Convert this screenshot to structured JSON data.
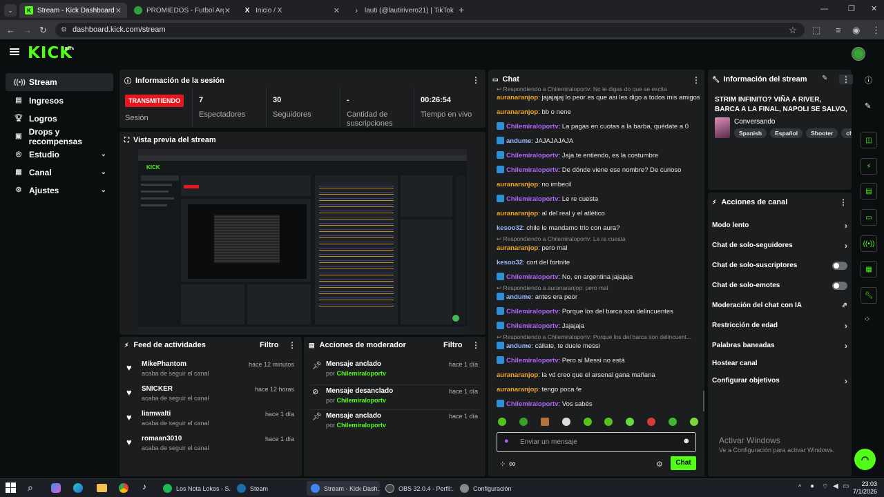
{
  "browser": {
    "tabs": [
      {
        "title": "Stream - Kick Dashboard",
        "icon": "kick-icon"
      },
      {
        "title": "PROMIEDOS - Futbol Argentino",
        "icon": "promiedos-icon"
      },
      {
        "title": "Inicio / X",
        "icon": "x-icon"
      },
      {
        "title": "lauti (@lautirivero21) | TikTok",
        "icon": "tiktok-icon"
      }
    ],
    "url": "dashboard.kick.com/stream"
  },
  "header": {
    "logo": "KICK",
    "logo_badge": "BETA"
  },
  "sidebar": {
    "items": [
      {
        "label": "Stream",
        "icon": "stream-icon",
        "active": true
      },
      {
        "label": "Ingresos",
        "icon": "revenue-icon"
      },
      {
        "label": "Logros",
        "icon": "trophy-icon"
      },
      {
        "label": "Drops y recompensas",
        "icon": "gift-icon"
      },
      {
        "label": "Estudio",
        "icon": "studio-icon",
        "expandable": true
      },
      {
        "label": "Canal",
        "icon": "channel-icon",
        "expandable": true
      },
      {
        "label": "Ajustes",
        "icon": "settings-icon",
        "expandable": true
      }
    ]
  },
  "session": {
    "title": "Información de la sesión",
    "status_badge": "TRANSMITIENDO",
    "stats": [
      {
        "value": "",
        "label": "Sesión"
      },
      {
        "value": "7",
        "label": "Espectadores"
      },
      {
        "value": "30",
        "label": "Seguidores"
      },
      {
        "value": "-",
        "label": "Cantidad de suscripciones"
      },
      {
        "value": "00:26:54",
        "label": "Tiempo en vivo"
      }
    ]
  },
  "preview": {
    "title": "Vista previa del stream"
  },
  "activity": {
    "title": "Feed de actividades",
    "filter": "Filtro",
    "items": [
      {
        "name": "MikePhantom",
        "sub": "acaba de seguir el canal",
        "time": "hace 12 minutos"
      },
      {
        "name": "SNICKER",
        "sub": "acaba de seguir el canal",
        "time": "hace 12 horas"
      },
      {
        "name": "liamwalti",
        "sub": "acaba de seguir el canal",
        "time": "hace 1 día"
      },
      {
        "name": "romaan3010",
        "sub": "acaba de seguir el canal",
        "time": "hace 1 día"
      }
    ]
  },
  "modactions": {
    "title": "Acciones de moderador",
    "filter": "Filtro",
    "items": [
      {
        "action": "Mensaje anclado",
        "by": "por",
        "user": "Chilemiraloportv",
        "time": "hace 1 día"
      },
      {
        "action": "Mensaje desanclado",
        "by": "por",
        "user": "Chilemiraloportv",
        "time": "hace 1 día"
      },
      {
        "action": "Mensaje anclado",
        "by": "por",
        "user": "Chilemiraloportv",
        "time": "hace 1 día"
      }
    ]
  },
  "chat": {
    "title": "Chat",
    "top_reply": "Respondiendo a Chilemiraloportv: No le digas do que se excita",
    "lines": [
      {
        "user": "auranaranjop",
        "color": "o",
        "text": "jajajajaj lo peor es que asi les digo a todos mis amigos"
      },
      {
        "user": "auranaranjop",
        "color": "o",
        "text": "bb o nene"
      },
      {
        "user": "Chilemiraloportv",
        "color": "p",
        "badge": true,
        "text": "La pagas en cuotas a la barba, quédate a 0"
      },
      {
        "user": "andume",
        "color": "b",
        "badge": true,
        "text": "JAJAJAJAJA"
      },
      {
        "user": "Chilemiraloportv",
        "color": "p",
        "badge": true,
        "text": "Jaja te entiendo, es la costumbre"
      },
      {
        "user": "Chilemiraloportv",
        "color": "p",
        "badge": true,
        "text": "De dónde viene ese nombre? De curioso"
      },
      {
        "user": "auranaranjop",
        "color": "o",
        "text": "no imbecil"
      },
      {
        "user": "Chilemiraloportv",
        "color": "p",
        "badge": true,
        "text": "Le re cuesta"
      },
      {
        "user": "auranaranjop",
        "color": "o",
        "text": "al del real y el atlético"
      },
      {
        "user": "kesoo32",
        "color": "b",
        "text": "chile le mandamo trio con aura?"
      },
      {
        "reply": "Respondiendo a Chilemiraloportv: Le re cuesta",
        "user": "auranaranjop",
        "color": "o",
        "text": "pero mal"
      },
      {
        "user": "kesoo32",
        "color": "b",
        "text": "cort del fortnite"
      },
      {
        "user": "Chilemiraloportv",
        "color": "p",
        "badge": true,
        "text": "No, en argentina jajajaja"
      },
      {
        "reply": "Respondiendo a auranaranjop: pero mal",
        "user": "andume",
        "color": "b",
        "badge": true,
        "text": "antes era peor"
      },
      {
        "user": "Chilemiraloportv",
        "color": "p",
        "badge": true,
        "text": "Porque los del barca son delincuentes"
      },
      {
        "user": "Chilemiraloportv",
        "color": "p",
        "badge": true,
        "text": "Jajajaja"
      },
      {
        "reply": "Respondiendo a Chilemiraloportv: Porque los del barca son delincuent...",
        "user": "andume",
        "color": "b",
        "badge": true,
        "text": "cállate, te duele messi"
      },
      {
        "user": "Chilemiraloportv",
        "color": "p",
        "badge": true,
        "text": "Pero si Messi no está"
      },
      {
        "user": "auranaranjop",
        "color": "o",
        "text": "la vd creo que el arsenal gana mañana"
      },
      {
        "user": "auranaranjop",
        "color": "o",
        "text": "tengo poca fe"
      },
      {
        "user": "Chilemiraloportv",
        "color": "p",
        "badge": true,
        "text": "Vos sabés"
      }
    ],
    "input_placeholder": "Enviar un mensaje",
    "send": "Chat",
    "infinity": "∞"
  },
  "streaminfo": {
    "title": "Información del stream",
    "stream_title": "STRIM INFINITO? VIÑA A RIVER, BARCA A LA FINAL, NAPOLI SE SALVO, MAÑANA...",
    "category": "Conversando",
    "tags": [
      "Spanish",
      "Español",
      "Shooter",
      "chill"
    ]
  },
  "channelactions": {
    "title": "Acciones de canal",
    "items": [
      {
        "label": "Modo lento",
        "control": "chevron"
      },
      {
        "label": "Chat de solo-seguidores",
        "control": "chevron"
      },
      {
        "label": "Chat de solo-suscriptores",
        "control": "toggle"
      },
      {
        "label": "Chat de solo-emotes",
        "control": "toggle"
      },
      {
        "label": "Moderación del chat con IA",
        "control": "external"
      },
      {
        "label": "Restricción de edad",
        "control": "chevron"
      },
      {
        "label": "Palabras baneadas",
        "control": "chevron"
      },
      {
        "label": "Hostear canal",
        "control": "none"
      },
      {
        "label": "Configurar objetivos",
        "control": "chevron"
      }
    ]
  },
  "watermark": {
    "title": "Activar Windows",
    "sub": "Ve a Configuración para activar Windows."
  },
  "taskbar": {
    "apps": [
      {
        "label": "Los Nota Lokos - S...",
        "color": "#1db954"
      },
      {
        "label": "Steam",
        "color": "#1b6fa8"
      },
      {
        "label": "Stream - Kick Dash...",
        "color": "#4285f4"
      },
      {
        "label": "OBS 32.0.4 - Perfil:...",
        "color": "#444"
      },
      {
        "label": "Configuración",
        "color": "#888"
      }
    ],
    "time": "23:03",
    "date": "7/1/2026"
  }
}
